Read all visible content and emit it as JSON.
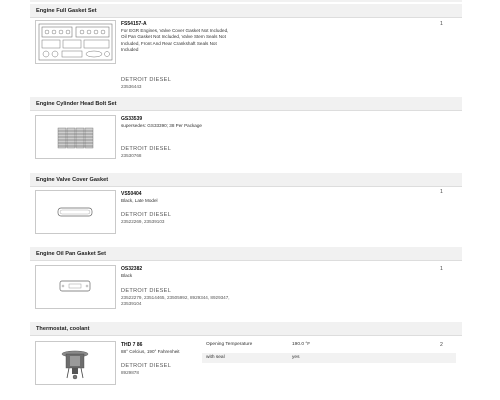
{
  "sections": [
    {
      "title": "Engine Full Gasket Set",
      "part_number": "FS54157-A",
      "description": "For EGR Engines, Valve Cover Gasket Not Included, Oil Pan Gasket Not Included, Valve Stem Seals Not Included, Front And Rear Crankshaft Seals Not Included",
      "brand": "DETROIT DIESEL",
      "codes": "23536443",
      "quantity": "1",
      "image_icon": "gasket-set-icon"
    },
    {
      "title": "Engine Cylinder Head Bolt Set",
      "part_number": "GS33539",
      "description": "supersedes: GS33390; 38 Per Package",
      "brand": "DETROIT DIESEL",
      "codes": "23530768",
      "quantity": "",
      "image_icon": "bolt-set-icon"
    },
    {
      "title": "Engine Valve Cover Gasket",
      "part_number": "VS50404",
      "description": "Black, Late Model",
      "brand": "DETROIT DIESEL",
      "codes": "23522269, 23539103",
      "quantity": "1",
      "image_icon": "valve-cover-gasket-icon"
    },
    {
      "title": "Engine Oil Pan Gasket Set",
      "part_number": "OS32382",
      "description": "Black",
      "brand": "DETROIT DIESEL",
      "codes": "23522279, 23514465, 23505992, 8929344, 8929347, 23539104",
      "quantity": "1",
      "image_icon": "oil-pan-gasket-icon"
    },
    {
      "title": "Thermostat, coolant",
      "part_number": "THD 7 86",
      "description": "88° Celcius, 190° Fahrenheit",
      "brand": "DETROIT DIESEL",
      "codes": "8929878",
      "quantity": "2",
      "image_icon": "thermostat-icon",
      "specs": [
        {
          "label": "Opening Temperature",
          "value": "190.0 °F"
        },
        {
          "label": "with seal",
          "value": "yes"
        }
      ]
    }
  ]
}
